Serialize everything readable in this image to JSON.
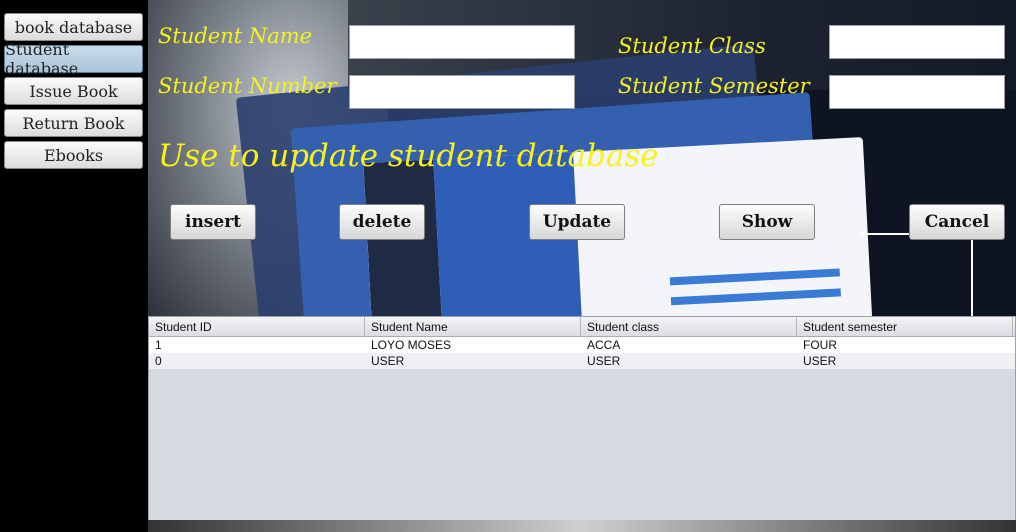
{
  "nav": {
    "items": [
      {
        "label": "book database"
      },
      {
        "label": "Student database"
      },
      {
        "label": "Issue Book"
      },
      {
        "label": "Return Book"
      },
      {
        "label": "Ebooks"
      }
    ]
  },
  "form": {
    "student_name_label": "Student Name",
    "student_name_value": "",
    "student_number_label": "Student Number",
    "student_number_value": "",
    "student_class_label": "Student Class",
    "student_class_value": "",
    "student_semester_label": "Student Semester",
    "student_semester_value": ""
  },
  "headline": "Use to update student database",
  "buttons": {
    "insert": "insert",
    "delete": "delete",
    "update": "Update",
    "show": "Show",
    "cancel": "Cancel"
  },
  "table": {
    "columns": [
      "Student ID",
      "Student Name",
      "Student class",
      "Student semester"
    ],
    "rows": [
      [
        "1",
        "LOYO MOSES",
        "ACCA",
        "FOUR"
      ],
      [
        "0",
        "USER",
        "USER",
        "USER"
      ]
    ]
  },
  "colors": {
    "label_yellow": "#f7f21a",
    "active_nav": "#a9c4d8"
  }
}
